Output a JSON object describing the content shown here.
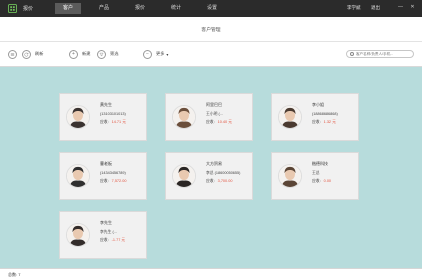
{
  "app": {
    "title": "报价"
  },
  "nav": {
    "tabs": [
      "客户",
      "产品",
      "报价",
      "统计",
      "设置"
    ],
    "active": 0
  },
  "top_links": {
    "user": "李学斌",
    "logout": "退出"
  },
  "window": {
    "minimize": "—",
    "close": "✕"
  },
  "page": {
    "title": "客户管理"
  },
  "toolbar": {
    "refresh": "刷新",
    "add": "新建",
    "filter": "筛选",
    "more": "更多",
    "more_arrow": "▾",
    "search_placeholder": "客户名称/负责人/手机..."
  },
  "customers": [
    {
      "name": "黄先生",
      "contact": "(13103101013)",
      "debt_label": "应收:",
      "debt": "14.71 元",
      "avatar_color": "#3a3230"
    },
    {
      "name": "阿里巴巴",
      "contact": "王小明 (...",
      "debt_label": "应收:",
      "debt": "10.40 元",
      "avatar_color": "#6b4f3c"
    },
    {
      "name": "李小姐",
      "contact": "(18868686868)",
      "debt_label": "应收:",
      "debt": "1.32 元",
      "avatar_color": "#4a3a30"
    },
    {
      "name": "曹老板",
      "contact": "(14343456789)",
      "debt_label": "应收:",
      "debt": "7,572.00",
      "avatar_color": "#2f2f2f"
    },
    {
      "name": "大方贸易",
      "contact": "李总 (18600050655)",
      "debt_label": "应收:",
      "debt": "3,700.00",
      "avatar_color": "#2a2624"
    },
    {
      "name": "楷德科技",
      "contact": "王总",
      "debt_label": "应收:",
      "debt": "0.00",
      "avatar_color": "#5a4536"
    },
    {
      "name": "李先生",
      "contact": "李先生 (...",
      "debt_label": "应收:",
      "debt": "-1.77 元",
      "avatar_color": "#332c2a"
    }
  ],
  "status": {
    "total_label": "总数:",
    "total": "7"
  },
  "colors": {
    "nav_bg": "#2b2b2b",
    "content_bg": "#b7dcdc",
    "debt": "#e2533f",
    "app_icon": "#4caf50"
  }
}
